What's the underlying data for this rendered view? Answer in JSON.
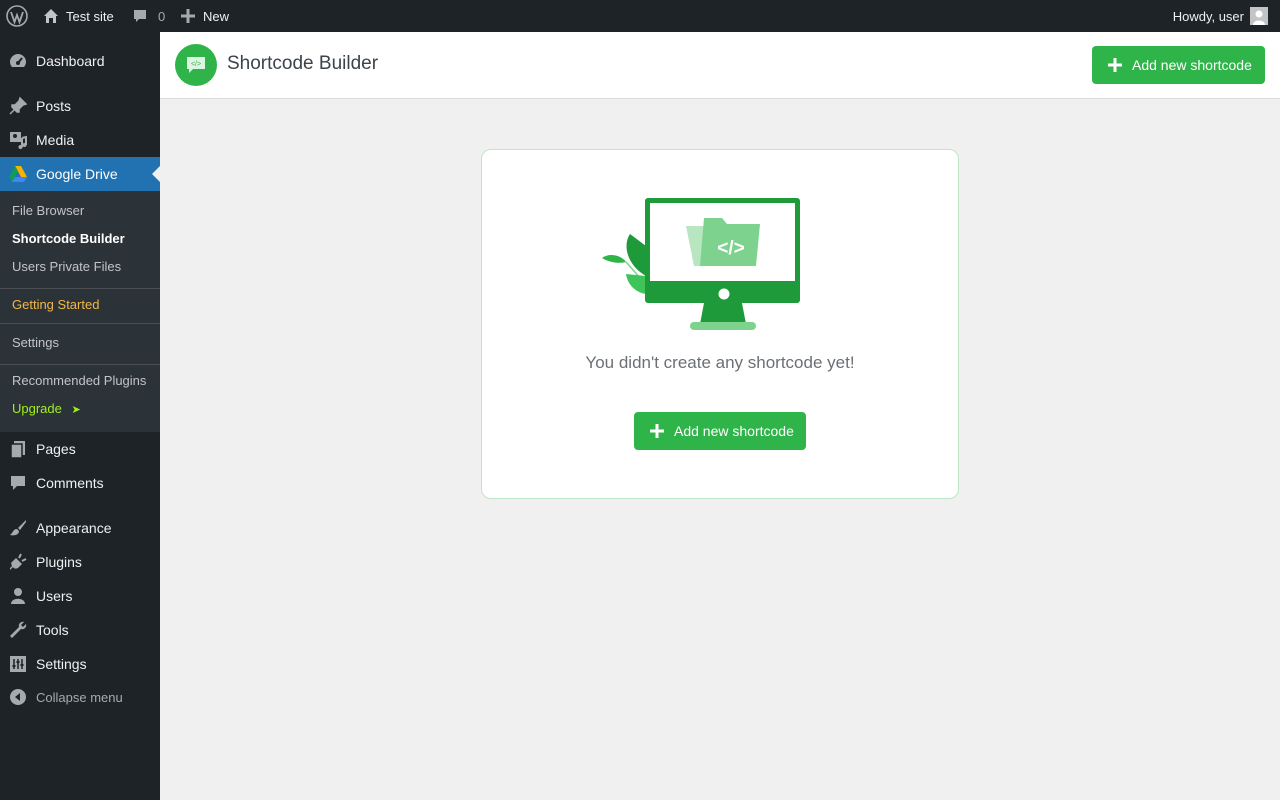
{
  "adminbar": {
    "site_name": "Test site",
    "comments_count": "0",
    "new_label": "New",
    "howdy": "Howdy, user"
  },
  "sidebar": {
    "items": [
      {
        "label": "Dashboard",
        "icon": "dashboard-icon"
      },
      {
        "label": "Posts",
        "icon": "pushpin-icon"
      },
      {
        "label": "Media",
        "icon": "media-icon"
      },
      {
        "label": "Google Drive",
        "icon": "google-drive-icon"
      },
      {
        "label": "Pages",
        "icon": "pages-icon"
      },
      {
        "label": "Comments",
        "icon": "comment-icon"
      },
      {
        "label": "Appearance",
        "icon": "paintbrush-icon"
      },
      {
        "label": "Plugins",
        "icon": "plugin-icon"
      },
      {
        "label": "Users",
        "icon": "user-icon"
      },
      {
        "label": "Tools",
        "icon": "wrench-icon"
      },
      {
        "label": "Settings",
        "icon": "settings-icon"
      }
    ],
    "submenu": [
      {
        "label": "File Browser"
      },
      {
        "label": "Shortcode Builder"
      },
      {
        "label": "Users Private Files"
      },
      {
        "label": "Getting Started"
      },
      {
        "label": "Settings"
      },
      {
        "label": "Recommended Plugins"
      },
      {
        "label": "Upgrade"
      }
    ],
    "upgrade_arrow": "➤",
    "collapse_label": "Collapse menu"
  },
  "header": {
    "title": "Shortcode Builder",
    "add_button": "Add new shortcode"
  },
  "main": {
    "empty_message": "You didn't create any shortcode yet!",
    "add_button": "Add new shortcode",
    "code_glyph": "</>"
  },
  "colors": {
    "accent_green": "#2fb44a",
    "wp_blue": "#2271b1",
    "admin_dark": "#1d2327"
  }
}
